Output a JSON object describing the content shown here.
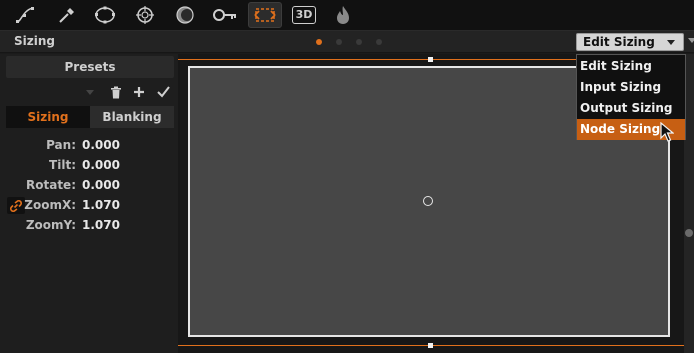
{
  "toolbar": {
    "tools": [
      {
        "icon": "curves-icon"
      },
      {
        "icon": "eyedropper-icon"
      },
      {
        "icon": "circle-window-icon"
      },
      {
        "icon": "tracker-icon"
      },
      {
        "icon": "blur-icon"
      },
      {
        "icon": "key-icon"
      },
      {
        "icon": "sizing-icon",
        "active": true
      },
      {
        "icon": "3d-icon",
        "label": "3D"
      },
      {
        "icon": "flame-icon"
      }
    ]
  },
  "header": {
    "title": "Sizing",
    "mode_selected": "Edit Sizing"
  },
  "left_panel": {
    "presets_label": "Presets",
    "tabs": [
      "Sizing",
      "Blanking"
    ],
    "params": [
      {
        "label": "Pan:",
        "value": "0.000"
      },
      {
        "label": "Tilt:",
        "value": "0.000"
      },
      {
        "label": "Rotate:",
        "value": "0.000"
      },
      {
        "label": "ZoomX:",
        "value": "1.070"
      },
      {
        "label": "ZoomY:",
        "value": "1.070"
      }
    ]
  },
  "dropdown": {
    "options": [
      "Edit Sizing",
      "Input Sizing",
      "Output Sizing",
      "Node Sizing"
    ],
    "highlighted": "Node Sizing"
  },
  "colors": {
    "accent": "#e0701c",
    "highlight": "#c75f13",
    "canvas": "#474747"
  }
}
